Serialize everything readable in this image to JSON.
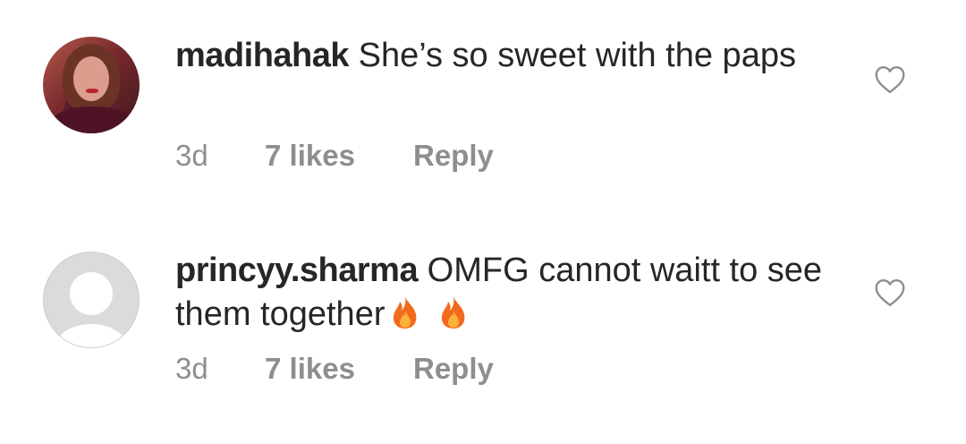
{
  "comments": [
    {
      "username": "madihahak",
      "text": "She’s so sweet with the paps",
      "time": "3d",
      "likes": "7 likes",
      "reply": "Reply",
      "avatar": "profile-photo",
      "emojis": []
    },
    {
      "username": "princyy.sharma",
      "text": "OMFG cannot waitt to see them together",
      "time": "3d",
      "likes": "7 likes",
      "reply": "Reply",
      "avatar": "default-avatar-icon",
      "emojis": [
        "fire-icon",
        "fire-icon"
      ]
    }
  ],
  "colors": {
    "text": "#262626",
    "meta": "#8e8e8e",
    "heart_outline": "#8e8e8e",
    "fire": "#f26b1d"
  }
}
